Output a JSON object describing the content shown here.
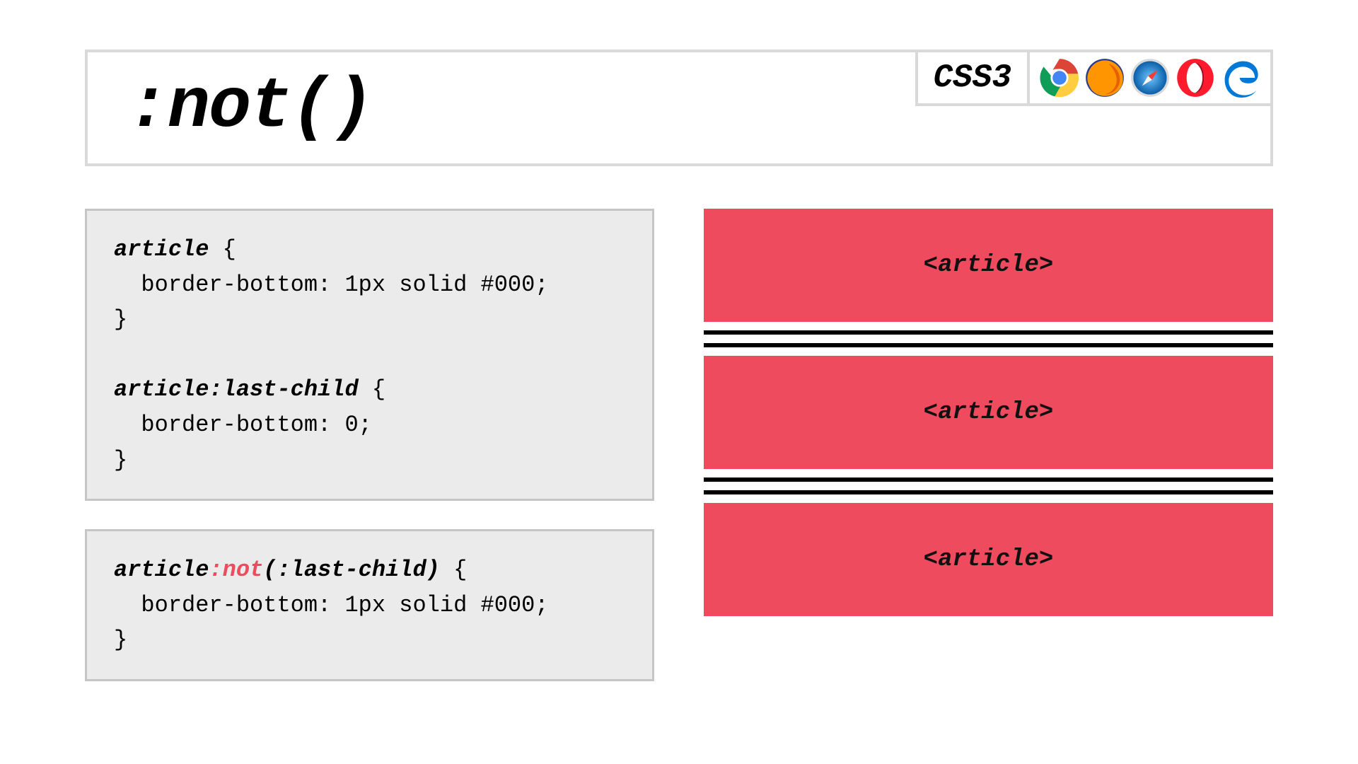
{
  "header": {
    "title": ":not()",
    "css_badge": "CSS3",
    "browsers": [
      "chrome",
      "firefox",
      "safari",
      "opera",
      "edge"
    ]
  },
  "code": {
    "block1": {
      "sel1": "article",
      "brace_open": " {",
      "rule1": "  border-bottom: 1px solid #000;",
      "brace_close": "}",
      "blank": "",
      "sel2_a": "article",
      "sel2_b": ":last-child",
      "rule2": "  border-bottom: 0;"
    },
    "block2": {
      "sel_a": "article",
      "sel_b": ":not",
      "sel_c": "(:last-child)",
      "brace_open": " {",
      "rule": "  border-bottom: 1px solid #000;",
      "brace_close": "}"
    }
  },
  "preview": {
    "article_label": "<article>"
  },
  "colors": {
    "accent": "#ee4b5f",
    "code_bg": "#ebebeb",
    "border": "#d9d9d9"
  }
}
